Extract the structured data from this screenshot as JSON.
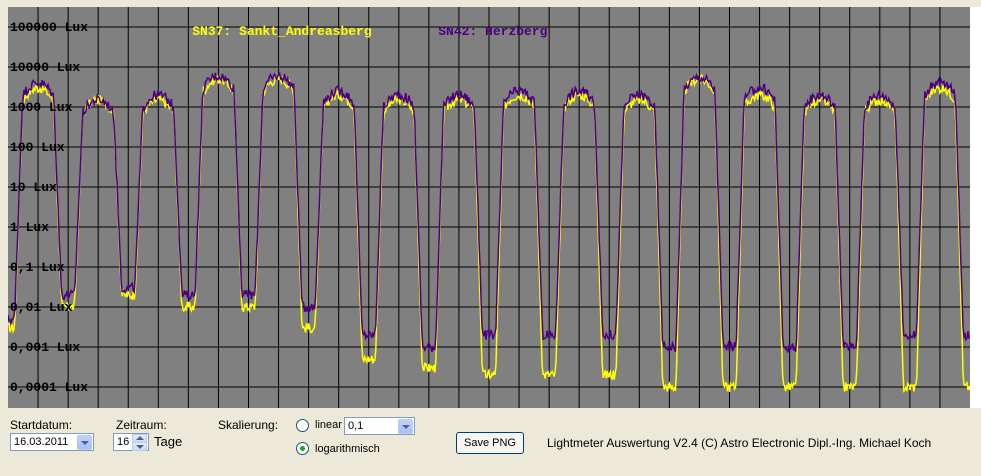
{
  "legend": {
    "series1": {
      "label": "SN37: Sankt_Andreasberg",
      "color": "#ffff00"
    },
    "series2": {
      "label": "SN42: Herzberg",
      "color": "#4b0082"
    }
  },
  "chart_data": {
    "type": "line",
    "scale": "log",
    "y_tick_labels": [
      "100000 Lux",
      "10000 Lux",
      "1000 Lux",
      "100 Lux",
      "10 Lux",
      "1 Lux",
      "0,1 Lux",
      "0,01 Lux",
      "0,001 Lux",
      "0,0001 Lux"
    ],
    "y_range": [
      0.0001,
      100000
    ],
    "x_range_days": 16,
    "grid": true,
    "series": [
      {
        "name": "SN37: Sankt_Andreasberg",
        "color": "#ffff00",
        "day_max": [
          3000,
          1500,
          1500,
          5000,
          5000,
          2000,
          1500,
          1500,
          2000,
          2000,
          1500,
          5000,
          2000,
          1500,
          1500,
          3000
        ],
        "night_min": [
          0.003,
          0.01,
          0.02,
          0.01,
          0.01,
          0.003,
          0.0005,
          0.0003,
          0.0002,
          0.0002,
          0.0002,
          0.0001,
          0.0001,
          0.0001,
          0.0001,
          0.0001
        ]
      },
      {
        "name": "SN42: Herzberg",
        "color": "#4b0082",
        "day_max": [
          4000,
          1500,
          2000,
          6000,
          6000,
          2500,
          2000,
          2000,
          2500,
          2500,
          2000,
          5500,
          3000,
          2000,
          2000,
          4000
        ],
        "night_min": [
          0.005,
          0.02,
          0.03,
          0.02,
          0.02,
          0.01,
          0.002,
          0.001,
          0.002,
          0.002,
          0.002,
          0.001,
          0.001,
          0.001,
          0.001,
          0.002
        ]
      }
    ]
  },
  "controls": {
    "startdatum_label": "Startdatum:",
    "startdatum_value": "16.03.2011",
    "zeitraum_label": "Zeitraum:",
    "zeitraum_value": "16",
    "tage_label": "Tage",
    "skalierung_label": "Skalierung:",
    "linear_label": "linear",
    "linear_value": "0,1",
    "log_label": "logarithmisch",
    "log_selected": true,
    "save_label": "Save PNG",
    "footer_text": "Lightmeter Auswertung V2.4  (C) Astro Electronic Dipl.-Ing. Michael Koch"
  }
}
